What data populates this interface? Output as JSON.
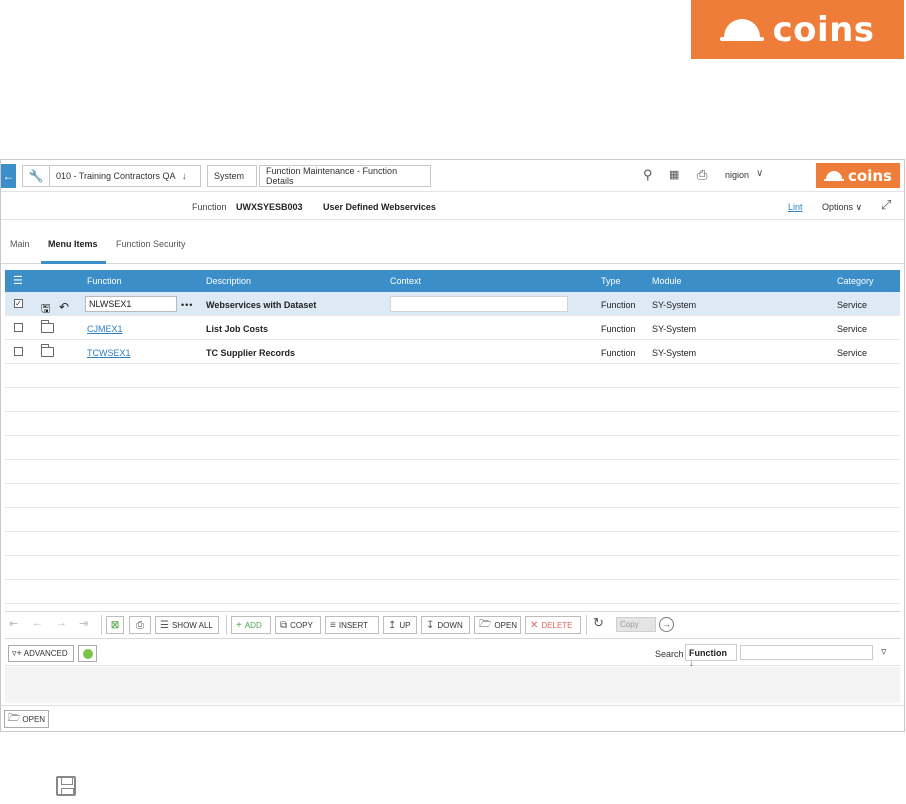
{
  "brand": {
    "name": "coins",
    "color": "#ef7d3a"
  },
  "topbar": {
    "back_icon": "arrow-left-icon",
    "wrench_icon": "wrench-icon",
    "company": "010 - Training Contractors QA",
    "module": "System",
    "page": "Function Maintenance - Function Details",
    "user": "nigion"
  },
  "header": {
    "function_label": "Function",
    "function_code": "UWXSYESB003",
    "function_description": "User Defined Webservices",
    "lint": "Lint",
    "options": "Options"
  },
  "tabs": [
    {
      "label": "Main",
      "active": false
    },
    {
      "label": "Menu Items",
      "active": true
    },
    {
      "label": "Function Security",
      "active": false
    }
  ],
  "grid": {
    "columns": [
      "Function",
      "Description",
      "Context",
      "Type",
      "Module",
      "Category"
    ],
    "rows": [
      {
        "function": "NLWSEX1",
        "description": "Webservices with Dataset",
        "context": "",
        "type": "Function",
        "module": "SY-System",
        "category": "Service",
        "selected": true,
        "checked": true
      },
      {
        "function": "CJMEX1",
        "description": "List Job Costs",
        "context": "",
        "type": "Function",
        "module": "SY-System",
        "category": "Service",
        "selected": false,
        "checked": false
      },
      {
        "function": "TCWSEX1",
        "description": "TC Supplier Records",
        "context": "",
        "type": "Function",
        "module": "SY-System",
        "category": "Service",
        "selected": false,
        "checked": false
      }
    ]
  },
  "toolbar": {
    "show_all": "SHOW ALL",
    "add": "ADD",
    "copy": "COPY",
    "insert": "INSERT",
    "up": "UP",
    "down": "DOWN",
    "open": "OPEN",
    "delete": "DELETE",
    "copy_placeholder": "Copy"
  },
  "search": {
    "advanced": "ADVANCED",
    "label": "Search",
    "field": "Function"
  },
  "bottom": {
    "open": "OPEN"
  }
}
